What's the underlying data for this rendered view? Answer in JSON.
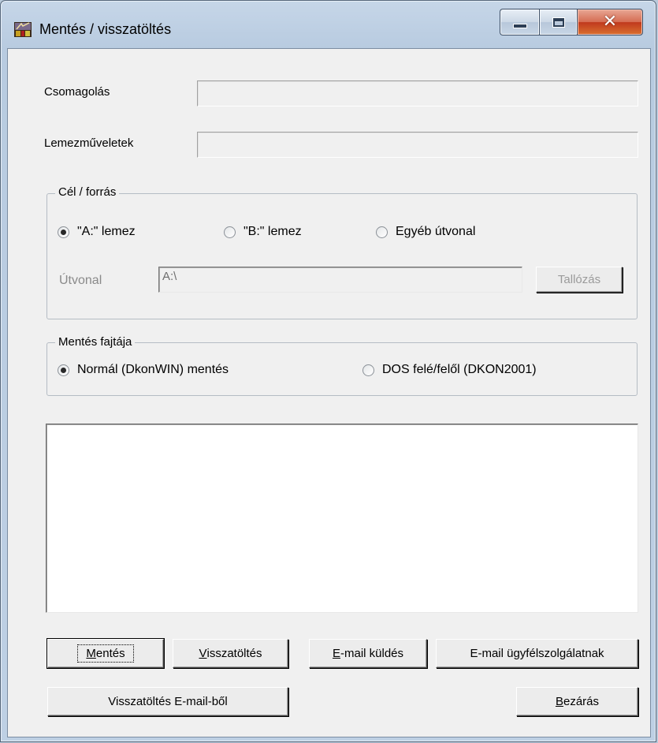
{
  "window": {
    "title": "Mentés / visszatöltés"
  },
  "progress": {
    "packing_label": "Csomagolás",
    "disk_ops_label": "Lemezműveletek"
  },
  "target_group": {
    "title": "Cél / forrás",
    "options": [
      {
        "label": "\"A:\" lemez",
        "selected": true
      },
      {
        "label": "\"B:\" lemez",
        "selected": false
      },
      {
        "label": "Egyéb útvonal",
        "selected": false
      }
    ],
    "path_label": "Útvonal",
    "path_value": "A:\\",
    "browse_label": "Tallózás"
  },
  "type_group": {
    "title": "Mentés fajtája",
    "options": [
      {
        "label": "Normál (DkonWIN) mentés",
        "selected": true
      },
      {
        "label": "DOS felé/felől (DKON2001)",
        "selected": false
      }
    ]
  },
  "buttons": {
    "save": {
      "accel": "M",
      "rest": "entés"
    },
    "restore": {
      "accel": "V",
      "rest": "isszatöltés"
    },
    "send_email": {
      "accel": "E",
      "rest": "-mail küldés"
    },
    "email_support": "E-mail ügyfélszolgálatnak",
    "restore_from_email": "Visszatöltés E-mail-ből",
    "close": {
      "accel": "B",
      "rest": "ezárás"
    }
  },
  "colors": {
    "client_bg": "#f0f0f0",
    "close_button": "#c0391d",
    "title_bar": "#b8cbe0"
  }
}
